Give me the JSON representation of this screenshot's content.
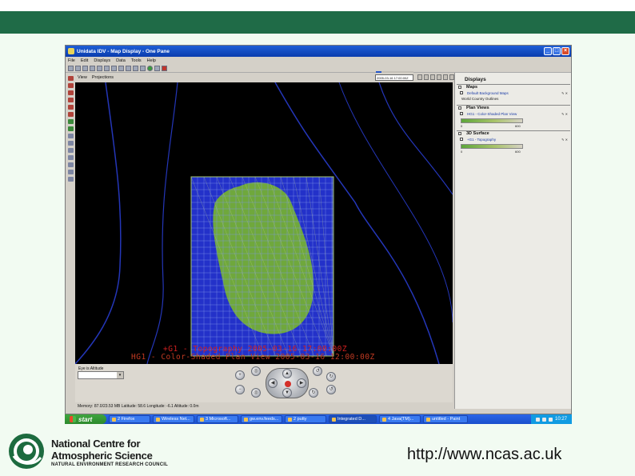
{
  "window": {
    "title": "Unidata IDV - Map Display - One Pane",
    "menu": [
      "File",
      "Edit",
      "Displays",
      "Data",
      "Tools",
      "Help"
    ]
  },
  "viewbar": {
    "view_label": "View",
    "projections_label": "Projections",
    "time_value": "2005-03-16 17:00:00Z",
    "animation_progress": 0.15
  },
  "map": {
    "caption_line1": "+G1 - Topography 2005-03-16 17:00:00Z",
    "caption_line2": "HG1 - Color-Shaded Plan View 2005-03-16 12:00:00Z"
  },
  "controls": {
    "altitude_label": "Eye is Altitude",
    "altitude_value": ""
  },
  "status": {
    "text": "Memory: 87.0/23.53 MB   Latitude: 58.6  Longitude: -6.1  Altitude: 0.0m"
  },
  "sidebar": {
    "title": "Displays",
    "sections": [
      {
        "label": "Maps",
        "items": [
          "Default Background Maps",
          "World Country Outlines"
        ]
      },
      {
        "label": "Plan Views",
        "items": [
          "HG1 - Color-Shaded Plan View"
        ],
        "colorbar": {
          "min": "0",
          "max": "600"
        }
      },
      {
        "label": "3D Surface",
        "items": [
          "+G1 - Topography"
        ],
        "colorbar": {
          "min": "0",
          "max": "600"
        }
      }
    ]
  },
  "taskbar": {
    "start_label": "start",
    "tasks": [
      "2 Firefox",
      "Wireless Net...",
      "3 Microsoft...",
      "gw.env.feeds...",
      "2 putty",
      "Integrated D...",
      "4 Java(TM)...",
      "untitled - Paint"
    ],
    "clock": "10:27"
  },
  "footer": {
    "org_line1": "National Centre for",
    "org_line2": "Atmospheric Science",
    "org_line3": "NATURAL ENVIRONMENT RESEARCH COUNCIL",
    "url": "http://www.ncas.ac.uk"
  },
  "colors": {
    "header_bar": "#1f6b47",
    "slide_background": "#f2fbf2",
    "grid_blue": "#2a3fd6",
    "terrain_green": "#6fa83c"
  }
}
